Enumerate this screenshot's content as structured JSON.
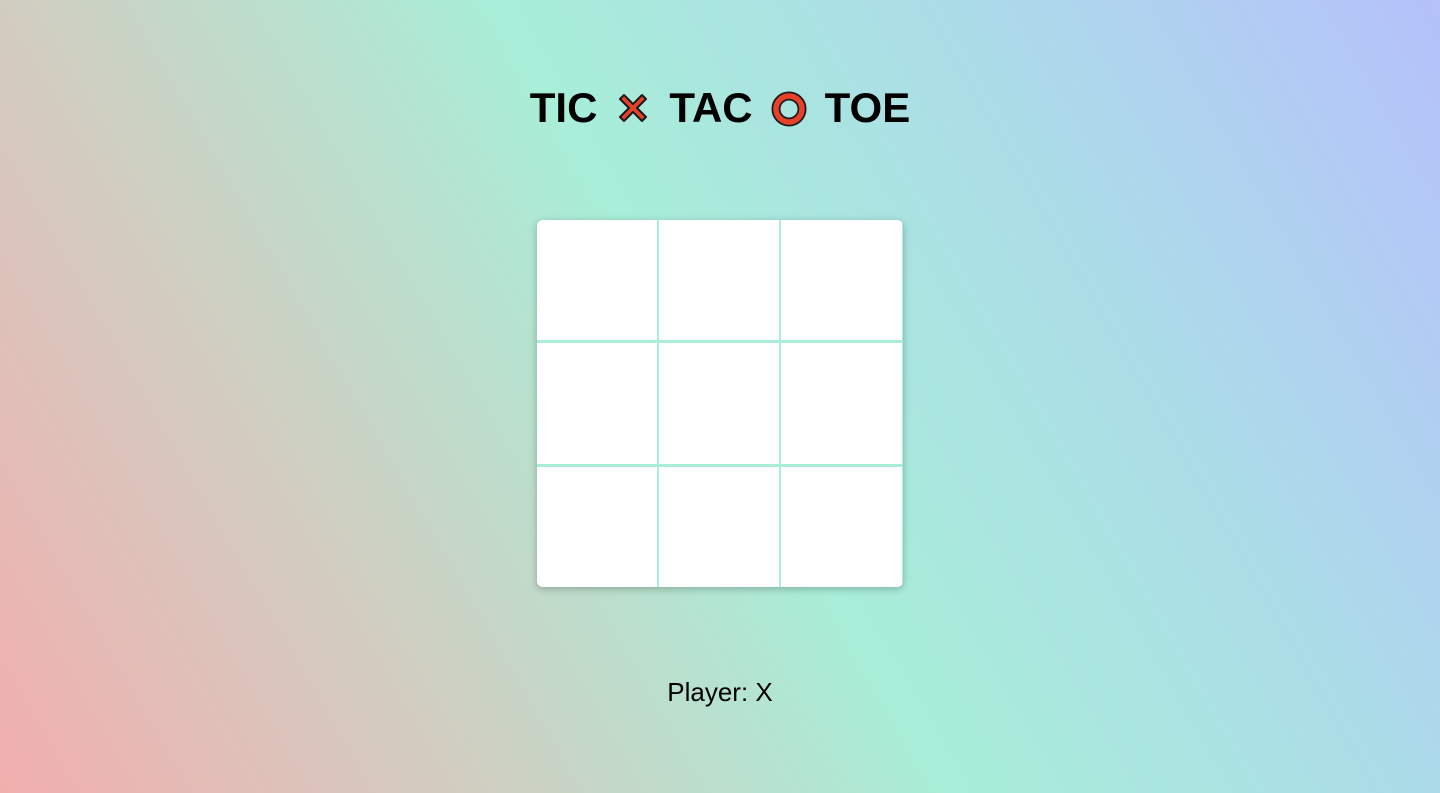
{
  "title": {
    "word1": "TIC",
    "word2": "TAC",
    "word3": "TOE",
    "icon1": "x-mark-icon",
    "icon2": "o-mark-icon",
    "icon_color": "#e8412a"
  },
  "board": {
    "cells": [
      "",
      "",
      "",
      "",
      "",
      "",
      "",
      "",
      ""
    ]
  },
  "status": {
    "text": "Player: X"
  }
}
